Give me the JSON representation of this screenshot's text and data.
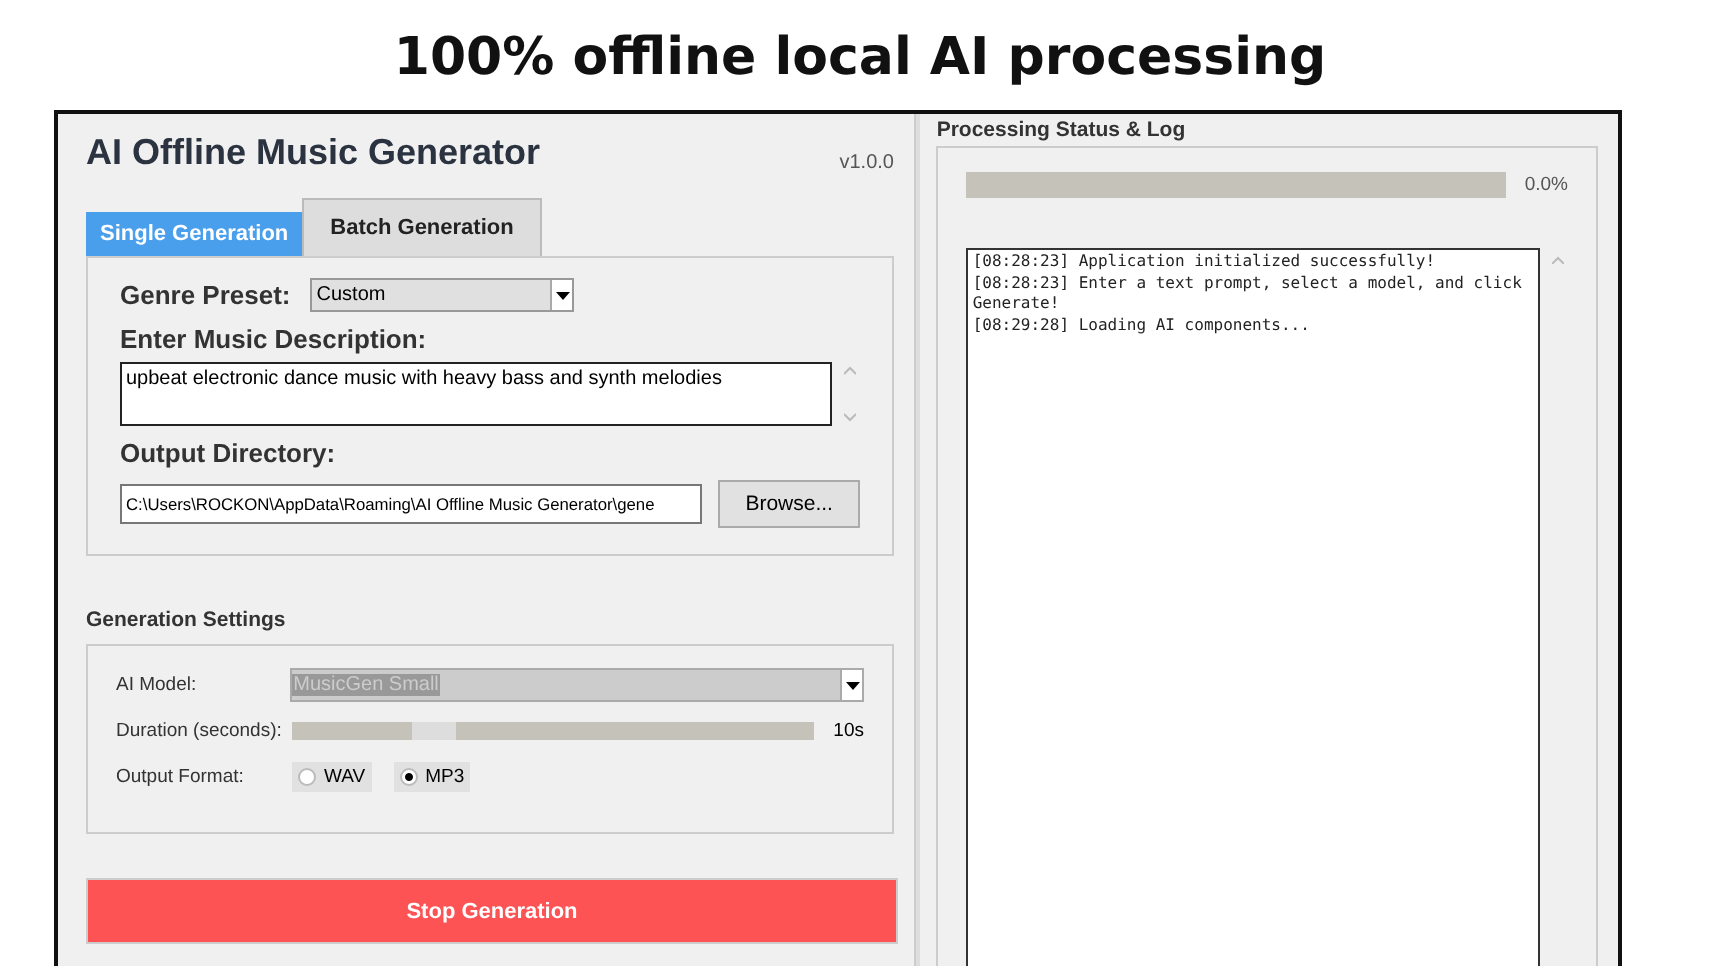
{
  "headline": "100% offline local AI processing",
  "app": {
    "title": "AI Offline Music Generator",
    "version": "v1.0.0"
  },
  "tabs": [
    {
      "label": "Single Generation",
      "selected": true
    },
    {
      "label": "Batch Generation",
      "selected": false
    }
  ],
  "form": {
    "genre_label": "Genre Preset:",
    "genre_value": "Custom",
    "description_label": "Enter Music Description:",
    "description_value": "upbeat electronic dance music with heavy bass and synth melodies",
    "output_label": "Output Directory:",
    "output_value": "C:\\Users\\ROCKON\\AppData\\Roaming\\AI Offline Music Generator\\gene",
    "browse_button": "Browse..."
  },
  "settings": {
    "title": "Generation Settings",
    "model_label": "AI Model:",
    "model_value": "MusicGen Small",
    "duration_label": "Duration (seconds):",
    "duration": {
      "level": 0.23,
      "reading": "10s"
    },
    "format_label": "Output Format:",
    "formats": [
      {
        "label": "WAV",
        "selected": false
      },
      {
        "label": "MP3",
        "selected": true
      }
    ]
  },
  "stop_button": "Stop Generation",
  "status": {
    "title": "Processing Status & Log",
    "progress": {
      "level": 0,
      "reading": "0.0%"
    },
    "log": [
      "[08:28:23] Application initialized successfully!",
      "[08:28:23] Enter a text prompt, select a model, and click Generate!",
      "[08:29:28] Loading AI components..."
    ]
  }
}
